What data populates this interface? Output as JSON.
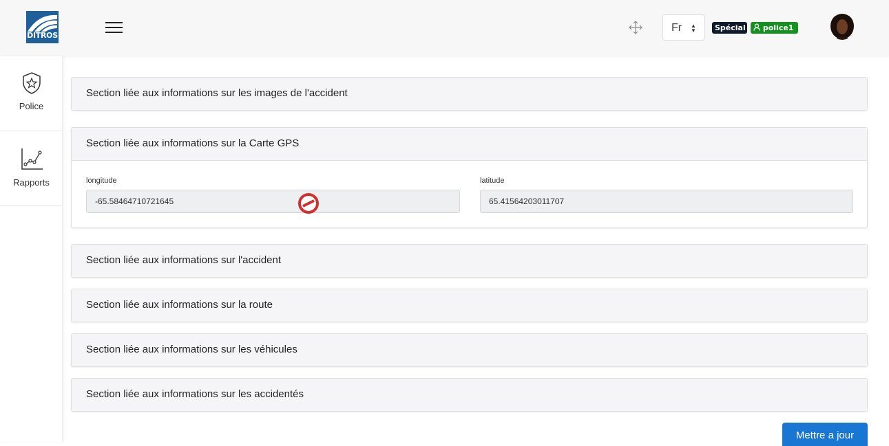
{
  "header": {
    "logo_text": "DITROS",
    "language": "Fr",
    "badge_role": "Spécial",
    "badge_user": "police1"
  },
  "sidebar": {
    "items": [
      {
        "label": "Police",
        "icon": "shield-star-icon"
      },
      {
        "label": "Rapports",
        "icon": "line-chart-icon"
      }
    ]
  },
  "sections": {
    "images": "Section liée aux informations sur les images de l'accident",
    "gps": "Section liée aux informations sur la Carte GPS",
    "accident": "Section liée aux informations sur l'accident",
    "route": "Section liée aux informations sur la route",
    "vehicules": "Section liée aux informations sur les véhicules",
    "accidentes": "Section liée aux informations sur les accidentés"
  },
  "gps": {
    "longitude_label": "longitude",
    "longitude_value": "-65.58464710721645",
    "latitude_label": "latitude",
    "latitude_value": "65.41564203011707"
  },
  "actions": {
    "update_label": "Mettre a jour"
  },
  "colors": {
    "primary": "#1976d2",
    "badge_special": "#0d1b2a",
    "badge_police": "#16911f",
    "not_allowed": "#d32f2f"
  }
}
